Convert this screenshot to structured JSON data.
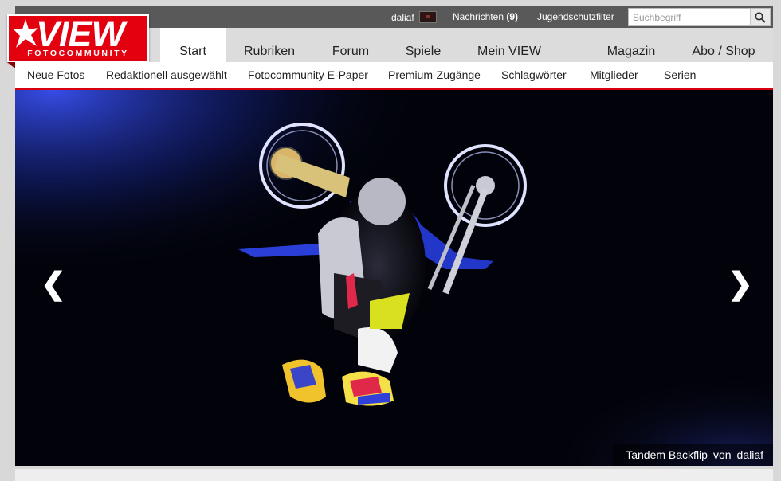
{
  "topbar": {
    "username": "daliaf",
    "messages_label": "Nachrichten",
    "messages_count": "(9)",
    "youth_filter": "Jugendschutzfilter",
    "search_placeholder": "Suchbegriff"
  },
  "logo": {
    "word": "VIEW",
    "subtitle": "FOTOCOMMUNITY"
  },
  "tabs": [
    {
      "label": "Start"
    },
    {
      "label": "Rubriken"
    },
    {
      "label": "Forum"
    },
    {
      "label": "Spiele"
    },
    {
      "label": "Mein VIEW"
    },
    {
      "label": "Magazin"
    },
    {
      "label": "Abo / Shop"
    }
  ],
  "active_tab": "Start",
  "subnav": [
    {
      "label": "Neue Fotos"
    },
    {
      "label": "Redaktionell ausgewählt"
    },
    {
      "label": "Fotocommunity E-Paper"
    },
    {
      "label": "Premium-Zugänge"
    },
    {
      "label": "Schlagwörter"
    },
    {
      "label": "Mitglieder"
    },
    {
      "label": "Serien"
    }
  ],
  "hero": {
    "prev_arrow": "❮",
    "next_arrow": "❯",
    "caption_title": "Tandem Backflip",
    "caption_by": "von",
    "caption_author": "daliaf"
  },
  "colors": {
    "brand_red": "#e3000f",
    "topbar": "#595959",
    "accent_blue": "#1f3bd6"
  },
  "icons": {
    "search": "search-icon",
    "avatar": "user-avatar-icon",
    "prev": "chevron-left-icon",
    "next": "chevron-right-icon"
  }
}
